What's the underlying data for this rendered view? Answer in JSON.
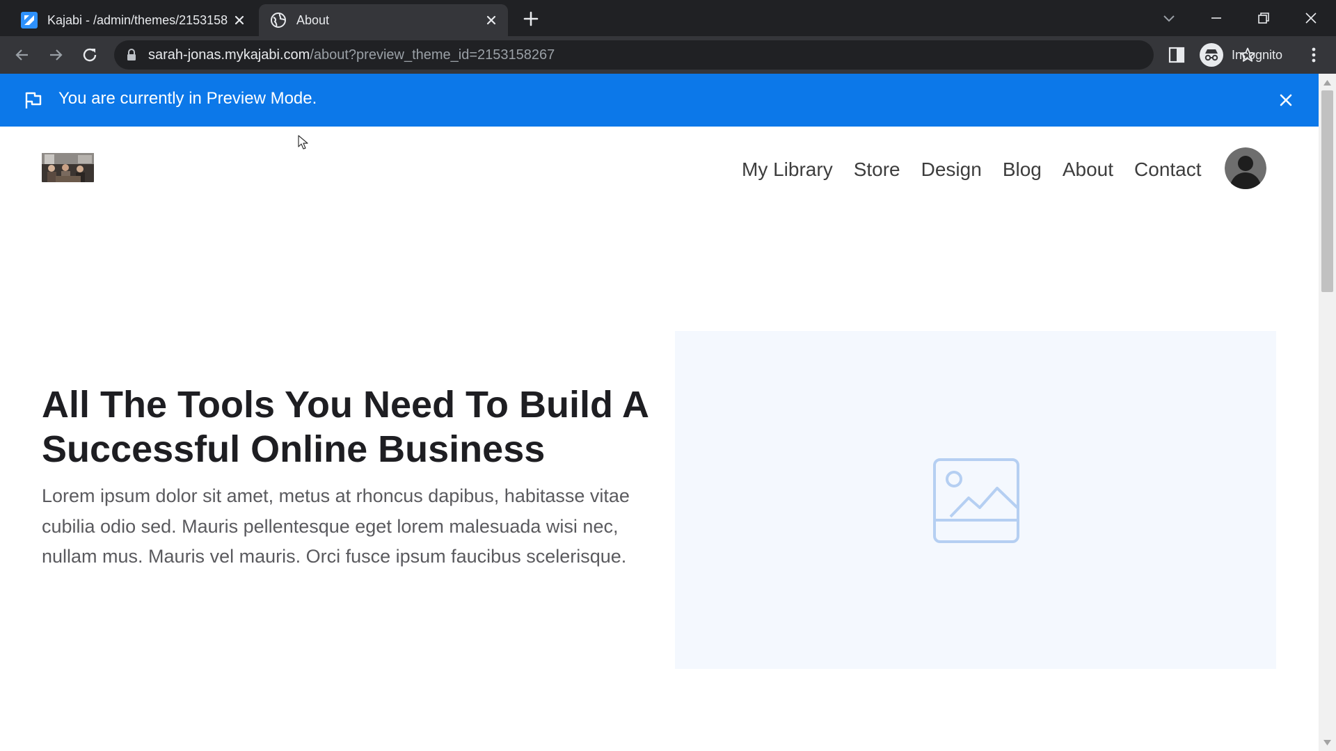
{
  "browser": {
    "tabs": [
      {
        "title": "Kajabi - /admin/themes/2153158",
        "favicon": "kajabi-icon",
        "active": false
      },
      {
        "title": "About",
        "favicon": "globe-icon",
        "active": true
      }
    ],
    "address_bar": {
      "host": "sarah-jonas.mykajabi.com",
      "path": "/about?preview_theme_id=2153158267"
    },
    "profile_label": "Incognito",
    "colors": {
      "tabstrip": "#202124",
      "toolbar": "#35363a",
      "omnibox": "#202124"
    }
  },
  "preview_banner": {
    "message": "You are currently in Preview Mode.",
    "color": "#0c78e9"
  },
  "site": {
    "nav": [
      "My Library",
      "Store",
      "Design",
      "Blog",
      "About",
      "Contact"
    ]
  },
  "hero": {
    "title": "All The Tools You Need To Build A Successful Online Business",
    "body": "Lorem ipsum dolor sit amet, metus at rhoncus dapibus, habitasse vitae cubilia odio sed. Mauris pellentesque eget lorem malesuada wisi nec, nullam mus. Mauris vel mauris. Orci fusce ipsum faucibus scelerisque."
  },
  "image_placeholder": {
    "icon": "image-icon",
    "background": "#f4f8fe",
    "icon_color": "#b5cff2"
  }
}
